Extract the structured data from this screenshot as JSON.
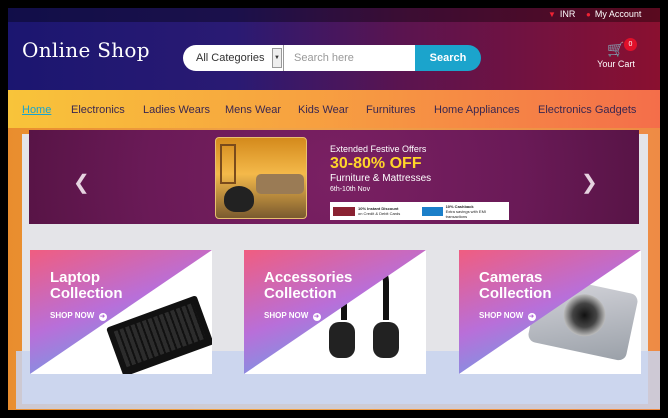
{
  "header": {
    "logo": "Online Shop",
    "top_links": [
      {
        "label": "INR",
        "icon": "rupee-icon"
      },
      {
        "label": "My Account",
        "icon": "user-icon"
      }
    ],
    "search": {
      "category": "All Categories",
      "placeholder": "Search here",
      "button": "Search"
    },
    "cart": {
      "label": "Your Cart",
      "count": "0"
    }
  },
  "nav": {
    "items": [
      {
        "label": "Home",
        "active": true
      },
      {
        "label": "Electronics"
      },
      {
        "label": "Ladies Wears"
      },
      {
        "label": "Mens Wear"
      },
      {
        "label": "Kids Wear"
      },
      {
        "label": "Furnitures"
      },
      {
        "label": "Home Appliances"
      },
      {
        "label": "Electronics Gadgets"
      }
    ]
  },
  "banner": {
    "title": "Extended Festive Offers",
    "discount": "30-80% OFF",
    "subtitle": "Furniture & Mattresses",
    "date": "6th-10th Nov",
    "offers": [
      {
        "label": "10% Instant Discount",
        "sub": "on Credit & Debit Cards"
      },
      {
        "label": "10% Cashback",
        "sub": "Extra savings with EMI transactions"
      }
    ]
  },
  "collections": [
    {
      "title": "Laptop\nCollection",
      "cta": "SHOP NOW"
    },
    {
      "title": "Accessories\nCollection",
      "cta": "SHOP NOW"
    },
    {
      "title": "Cameras\nCollection",
      "cta": "SHOP NOW"
    }
  ],
  "colors": {
    "accent": "#1ba4cc",
    "badge": "#e0102a",
    "offer": "#ffd52a"
  }
}
